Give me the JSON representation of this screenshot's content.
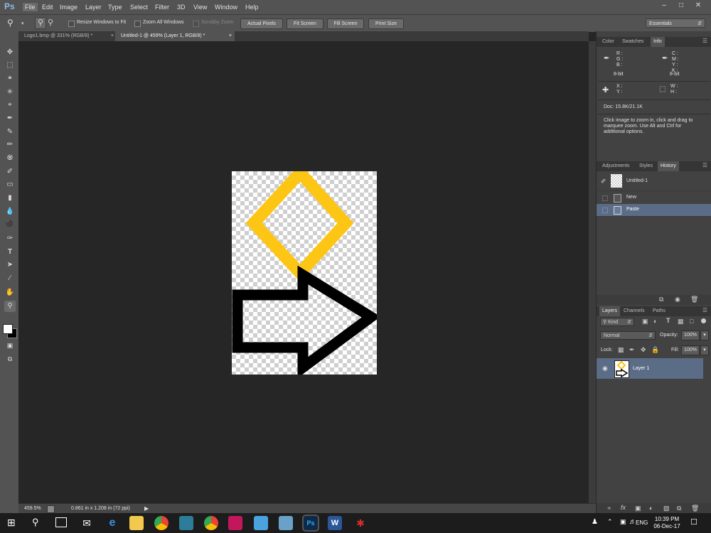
{
  "app": {
    "logo": "Ps"
  },
  "menu": [
    "File",
    "Edit",
    "Image",
    "Layer",
    "Type",
    "Select",
    "Filter",
    "3D",
    "View",
    "Window",
    "Help"
  ],
  "window_controls": [
    "–",
    "□",
    "✕"
  ],
  "options": {
    "resize_windows_to_fit": "Resize Windows to Fit",
    "zoom_all_windows": "Zoom All Windows",
    "scrubby_zoom": "Scrubby Zoom",
    "actual_pixels": "Actual Pixels",
    "fit_screen": "Fit Screen",
    "fill_screen": "Fill Screen",
    "print_size": "Print Size",
    "workspace": "Essentials"
  },
  "tabs": [
    {
      "label": "Logo1.bmp @ 331% (RGB/8) *",
      "active": false
    },
    {
      "label": "Untitled-1 @ 459% (Layer 1, RGB/8) *",
      "active": true
    }
  ],
  "status": {
    "zoom": "459.5%",
    "doc_info": "0.861 in x 1.208 in (72 ppi)"
  },
  "info_panel": {
    "tabs": [
      "Color",
      "Swatches",
      "Info"
    ],
    "rgb_labels": [
      "R :",
      "G :",
      "B :"
    ],
    "cmyk_labels": [
      "C :",
      "M :",
      "Y :",
      "K :"
    ],
    "bit_left": "8-bit",
    "bit_right": "8-bit",
    "xy_labels": [
      "X :",
      "Y :"
    ],
    "wh_labels": [
      "W :",
      "H :"
    ],
    "doc": "Doc: 15.8K/21.1K",
    "hint": "Click image to zoom in, click and drag to marquee zoom.  Use Alt and Ctrl for additional options."
  },
  "history_panel": {
    "tabs": [
      "Adjustments",
      "Styles",
      "History"
    ],
    "snapshot": "Untitled-1",
    "items": [
      "New",
      "Paste"
    ]
  },
  "layers_panel": {
    "tabs": [
      "Layers",
      "Channels",
      "Paths"
    ],
    "filter": "Kind",
    "blend_mode": "Normal",
    "opacity_label": "Opacity:",
    "opacity": "100%",
    "lock_label": "Lock:",
    "fill_label": "Fill:",
    "fill": "100%",
    "layer_name": "Layer 1"
  },
  "taskbar": {
    "lang": "ENG",
    "time": "10:39 PM",
    "date": "06-Dec-17"
  },
  "colors": {
    "accent_yellow": "#FDC514",
    "selected_row": "#5b6c86"
  }
}
